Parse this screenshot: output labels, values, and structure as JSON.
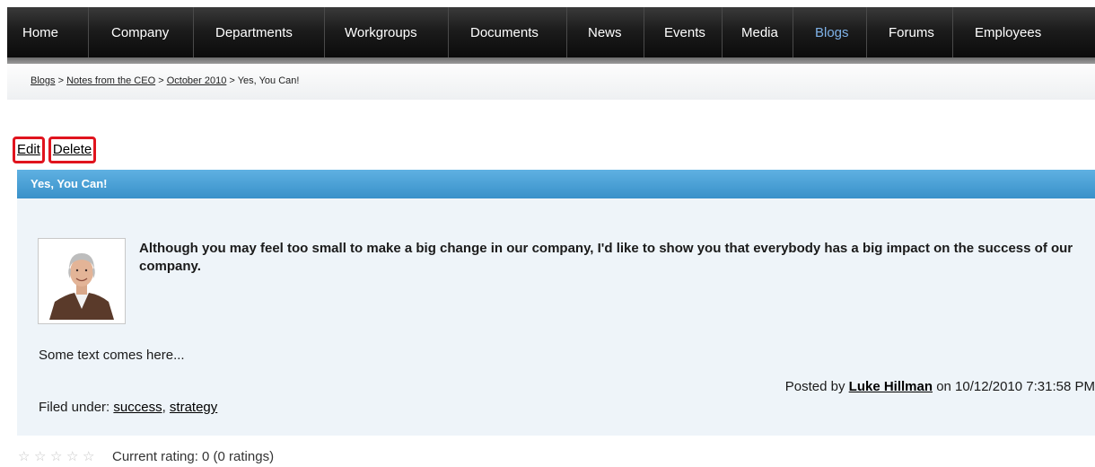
{
  "nav": {
    "items": [
      {
        "label": "Home"
      },
      {
        "label": "Company"
      },
      {
        "label": "Departments"
      },
      {
        "label": "Workgroups"
      },
      {
        "label": "Documents"
      },
      {
        "label": "News"
      },
      {
        "label": "Events"
      },
      {
        "label": "Media"
      },
      {
        "label": "Blogs",
        "active": true
      },
      {
        "label": "Forums"
      },
      {
        "label": "Employees"
      }
    ],
    "active_color": "#7fb2e8"
  },
  "breadcrumb": {
    "blogs": "Blogs",
    "notes": "Notes from the CEO",
    "month": "October 2010",
    "current": "Yes, You Can!",
    "separator": ">"
  },
  "actions": {
    "edit": "Edit",
    "delete": "Delete",
    "highlight_color": "#e0141e"
  },
  "post": {
    "title": "Yes, You Can!",
    "lead": "Although you may feel too small to make a big change in our company, I'd like to show you that everybody has a big impact on the success of our company.",
    "body": "Some text comes here...",
    "posted_prefix": "Posted by",
    "author": "Luke Hillman",
    "posted_on": "on 10/12/2010 7:31:58 PM",
    "filed_prefix": "Filed under:",
    "tags": [
      "success",
      "strategy"
    ],
    "header_color": "#3991c9"
  },
  "rating": {
    "stars_total": 5,
    "stars_filled": 0,
    "text": "Current rating: 0 (0 ratings)"
  }
}
